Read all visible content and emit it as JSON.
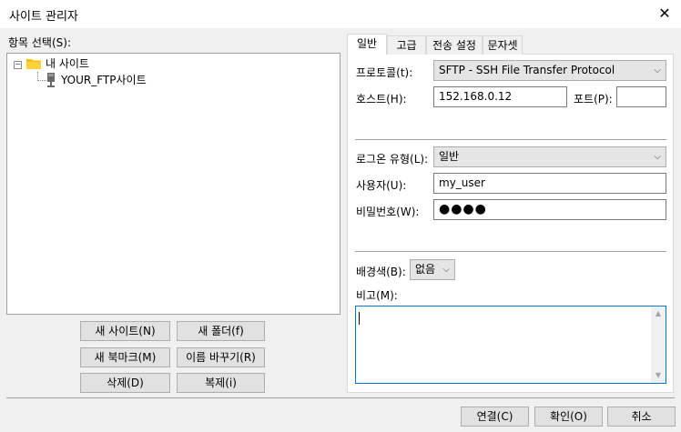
{
  "window": {
    "title": "사이트 관리자",
    "close_glyph": "✕"
  },
  "left": {
    "entry_label": "항목 선택(S):",
    "tree": {
      "collapse_glyph": "−",
      "root": "내 사이트",
      "child": "YOUR_FTP사이트"
    },
    "buttons": {
      "new_site": "새 사이트(N)",
      "new_folder": "새 폴더(f)",
      "new_bookmark": "새 북마크(M)",
      "rename": "이름 바꾸기(R)",
      "delete": "삭제(D)",
      "duplicate": "복제(i)"
    }
  },
  "tabs": [
    {
      "label": "일반",
      "active": true
    },
    {
      "label": "고급",
      "active": false
    },
    {
      "label": "전송 설정",
      "active": false
    },
    {
      "label": "문자셋",
      "active": false
    }
  ],
  "general": {
    "protocol_label": "프로토콜(t):",
    "protocol_value": "SFTP - SSH File Transfer Protocol",
    "host_label": "호스트(H):",
    "host_value": "152.168.0.12",
    "port_label": "포트(P):",
    "port_value": "",
    "logon_label": "로그온 유형(L):",
    "logon_value": "일반",
    "user_label": "사용자(U):",
    "user_value": "my_user",
    "password_label": "비밀번호(W):",
    "password_mask": "●●●●",
    "bgcolor_label": "배경색(B):",
    "bgcolor_value": "없음",
    "comments_label": "비고(M):",
    "comments_value": ""
  },
  "footer": {
    "connect": "연결(C)",
    "ok": "확인(O)",
    "cancel": "취소"
  },
  "icons": {
    "folder": "folder-icon",
    "server": "server-icon",
    "dropdown": "chevron-down-icon"
  },
  "colors": {
    "folder": "#f8c200",
    "accent": "#0078d7"
  }
}
